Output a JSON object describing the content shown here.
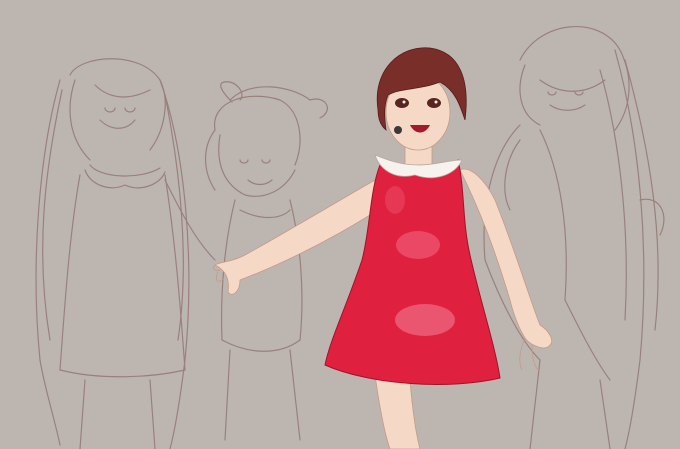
{
  "illustration": {
    "type": "digital sketch artwork",
    "background_color": "#bdb6b0",
    "sketch_line_color": "#8e6f6c",
    "dress_color": "#e0203f",
    "dress_highlight_color": "#f26a83",
    "collar_color": "#f7f2ee",
    "hair_color": "#7a2e2a",
    "skin_color": "#f5d9c6",
    "figures": [
      {
        "name": "sketch-girl-twin-tails-left",
        "style": "line sketch"
      },
      {
        "name": "sketch-girl-bow-center-left",
        "style": "line sketch"
      },
      {
        "name": "colored-girl-red-dress-center",
        "style": "colored"
      },
      {
        "name": "sketch-girl-long-hair-right",
        "style": "line sketch"
      }
    ]
  }
}
